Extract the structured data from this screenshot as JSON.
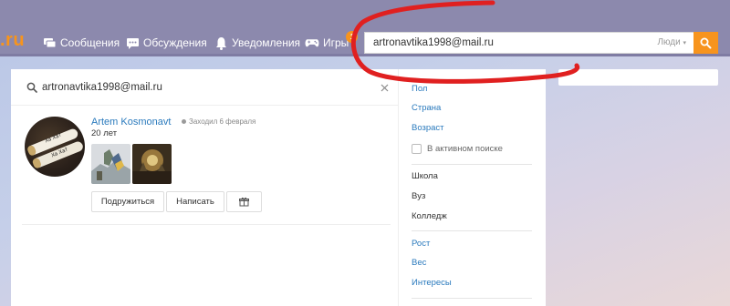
{
  "header": {
    "logo_fragment": ".ru",
    "nav": [
      {
        "label": "Сообщения",
        "icon": "messages-icon"
      },
      {
        "label": "Обсуждения",
        "icon": "discussions-icon"
      },
      {
        "label": "Уведомления",
        "icon": "bell-icon"
      },
      {
        "label": "Игры",
        "icon": "gamepad-icon",
        "badge": "1"
      }
    ],
    "search": {
      "value": "artronavtika1998@mail.ru",
      "type_label": "Люди"
    }
  },
  "results": {
    "search_value": "artronavtika1998@mail.ru",
    "user": {
      "name": "Artem Kosmonavt",
      "status": "Заходил 6 февраля",
      "age": "20 лет",
      "avatar_text": [
        "Ха Ха?",
        "Ха Ха?"
      ]
    },
    "buttons": {
      "friend": "Подружиться",
      "message": "Написать",
      "gift_icon": "gift-icon"
    }
  },
  "filters": {
    "gender": "Пол",
    "country": "Страна",
    "age": "Возраст",
    "active_search": "В активном поиске",
    "school": "Школа",
    "university": "Вуз",
    "college": "Колледж",
    "height": "Рост",
    "weight": "Вес",
    "interests": "Интересы"
  },
  "colors": {
    "accent": "#f7941d",
    "link": "#2a7abd",
    "topbar": "#8c89ad",
    "annotation": "#e02020"
  }
}
